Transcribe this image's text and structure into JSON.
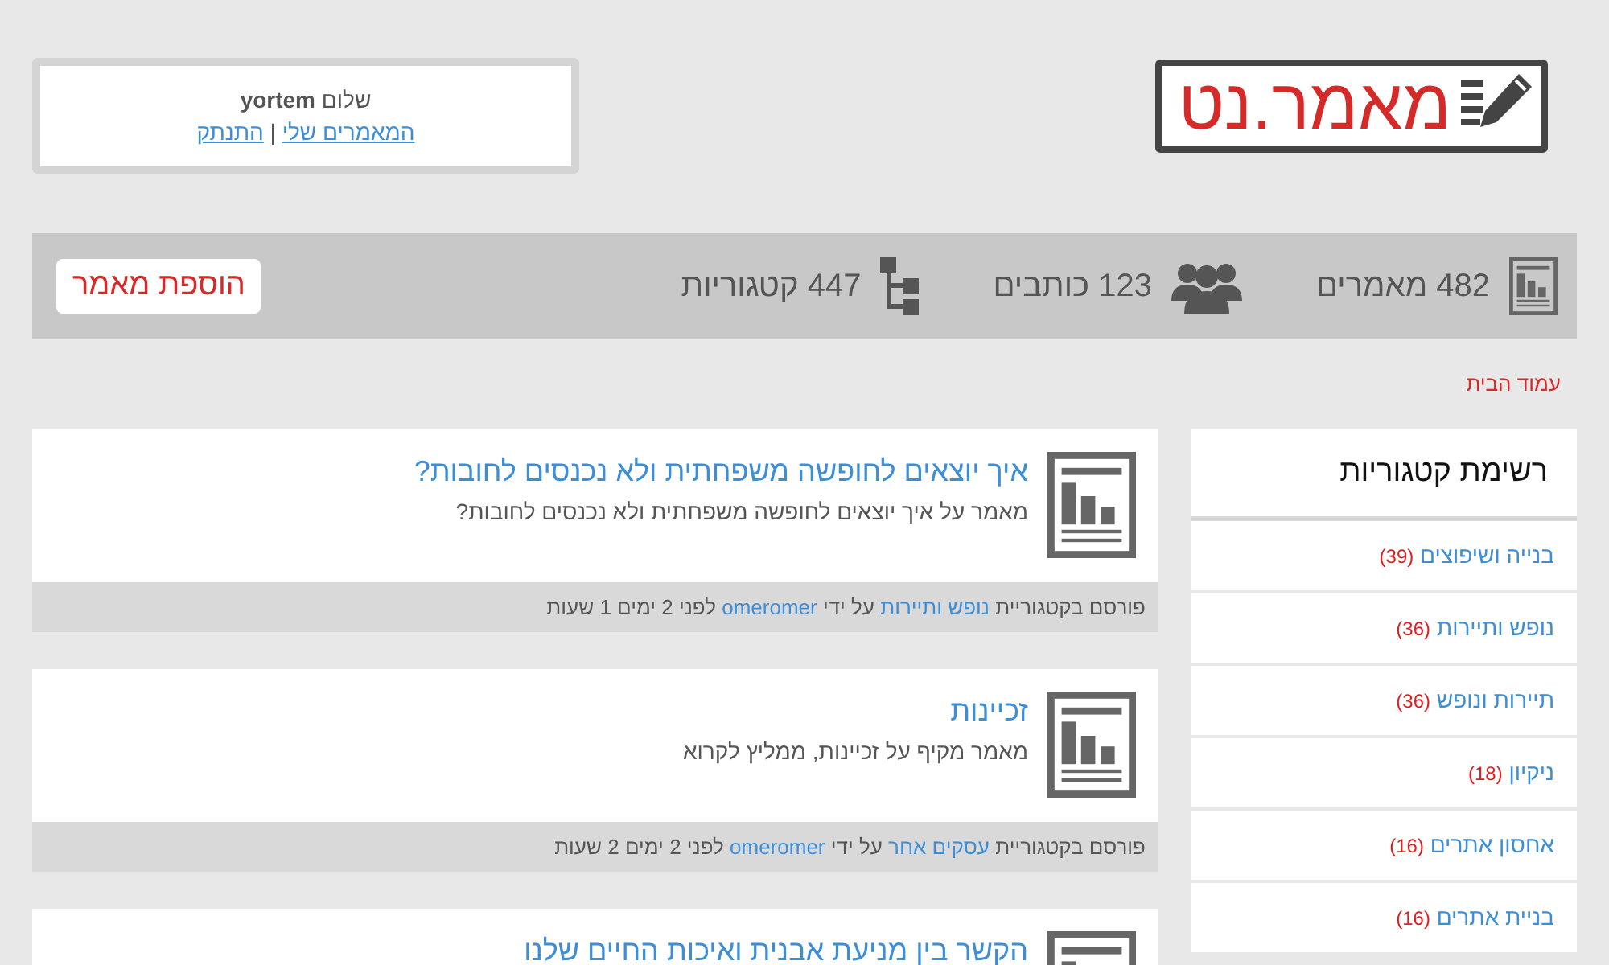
{
  "logo": {
    "text": "מאמר.נט"
  },
  "user_box": {
    "greeting": "שלום **yortem**",
    "links": [
      "המאמרים שלי",
      "התנתק"
    ],
    "separator": "|"
  },
  "stats": [
    {
      "kind": "articles",
      "text": "482 מאמרים"
    },
    {
      "kind": "writers",
      "text": "123 כותבים"
    },
    {
      "kind": "categories",
      "text": "447 קטגוריות"
    }
  ],
  "add_button": "הוספת מאמר",
  "breadcrumb": "עמוד הבית",
  "articles": [
    {
      "title": "איך יוצאים לחופשה משפחתית ולא נכנסים לחובות?",
      "summary": "מאמר על איך יוצאים לחופשה משפחתית ולא נכנסים לחובות?",
      "meta_prefix": "פורסם בקטגוריית",
      "category": "נופש ותיירות",
      "meta_by": "על ידי",
      "author": "omeromer",
      "meta_time": "לפני 2 ימים 1 שעות"
    },
    {
      "title": "זכיינות",
      "summary": "מאמר מקיף על זכיינות, ממליץ לקרוא",
      "meta_prefix": "פורסם בקטגוריית",
      "category": "עסקים אחר",
      "meta_by": "על ידי",
      "author": "omeromer",
      "meta_time": "לפני 2 ימים 2 שעות"
    },
    {
      "title": "הקשר בין מניעת אבנית ואיכות החיים שלנו"
    }
  ],
  "sidebar": {
    "title": "רשימת קטגוריות",
    "items": [
      {
        "name": "בנייה ושיפוצים",
        "count": "(39)"
      },
      {
        "name": "נופש ותיירות",
        "count": "(36)"
      },
      {
        "name": "תיירות ונופש",
        "count": "(36)"
      },
      {
        "name": "ניקיון",
        "count": "(18)"
      },
      {
        "name": "אחסון אתרים",
        "count": "(16)"
      },
      {
        "name": "בניית אתרים",
        "count": "(16)"
      }
    ]
  }
}
